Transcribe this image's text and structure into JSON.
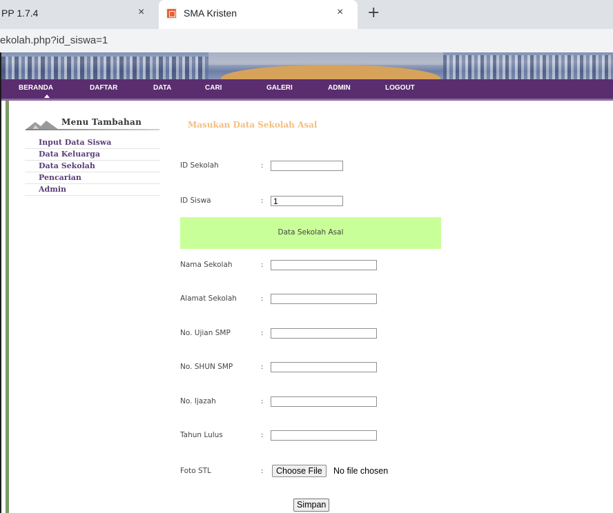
{
  "browser": {
    "tabs": [
      {
        "title": "PP 1.7.4",
        "close_glyph": "×"
      },
      {
        "title": "SMA Kristen",
        "close_glyph": "×"
      }
    ],
    "new_tab_glyph": "+",
    "url": "ekolah.php?id_siswa=1"
  },
  "nav": {
    "items": [
      "BERANDA",
      "DAFTAR",
      "DATA",
      "CARI",
      "GALERI",
      "ADMIN",
      "LOGOUT"
    ],
    "color": "#5a2d6e"
  },
  "sidebar": {
    "title": "Menu Tambahan",
    "items": [
      "Input Data Siswa",
      "Data Keluarga",
      "Data Sekolah",
      "Pencarian",
      "Admin"
    ]
  },
  "form": {
    "title": "Masukan Data Sekolah Asal",
    "colon": ":",
    "id_sekolah": {
      "label": "ID Sekolah",
      "value": ""
    },
    "id_siswa": {
      "label": "ID Siswa",
      "value": "1"
    },
    "section_title": "Data Sekolah Asal",
    "section_color": "#c9ff99",
    "nama_sekolah": {
      "label": "Nama Sekolah",
      "value": ""
    },
    "alamat_sekolah": {
      "label": "Alamat Sekolah",
      "value": ""
    },
    "no_ujian_smp": {
      "label": "No. Ujian SMP",
      "value": ""
    },
    "no_shun_smp": {
      "label": "No. SHUN SMP",
      "value": ""
    },
    "no_ijazah": {
      "label": "No. Ijazah",
      "value": ""
    },
    "tahun_lulus": {
      "label": "Tahun Lulus",
      "value": ""
    },
    "foto_stl": {
      "label": "Foto STL",
      "button_label": "Choose File",
      "status": "No file chosen"
    },
    "submit_label": "Simpan"
  }
}
